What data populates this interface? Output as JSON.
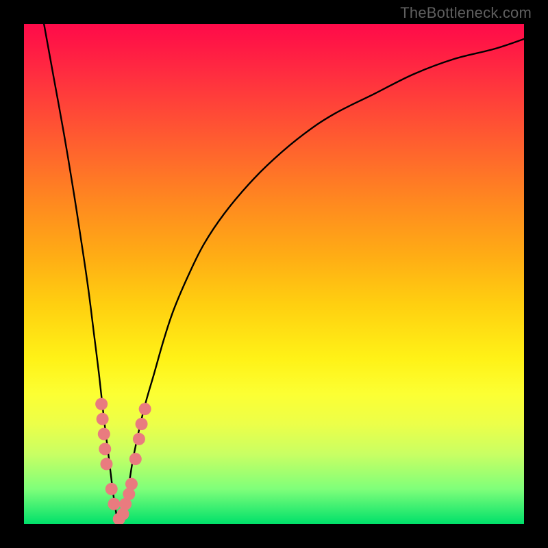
{
  "watermark": "TheBottleneck.com",
  "colors": {
    "curve_stroke": "#000000",
    "marker_fill": "#e97b7f",
    "gradient_top": "#ff0b4a",
    "gradient_bottom": "#00e06a",
    "frame": "#000000"
  },
  "chart_data": {
    "type": "line",
    "title": "",
    "xlabel": "",
    "ylabel": "",
    "xlim": [
      0,
      100
    ],
    "ylim": [
      0,
      100
    ],
    "series": [
      {
        "name": "bottleneck-curve",
        "x": [
          4,
          6,
          8,
          10,
          12,
          13,
          14,
          15,
          16,
          17,
          18,
          19,
          20,
          21,
          22,
          24,
          26,
          28,
          30,
          33,
          36,
          40,
          45,
          50,
          56,
          62,
          70,
          78,
          86,
          94,
          100
        ],
        "y": [
          100,
          89,
          78,
          66,
          53,
          46,
          38,
          30,
          21,
          13,
          5,
          0,
          2,
          8,
          14,
          23,
          30,
          37,
          43,
          50,
          56,
          62,
          68,
          73,
          78,
          82,
          86,
          90,
          93,
          95,
          97
        ]
      }
    ],
    "markers": [
      {
        "x": 15.5,
        "y": 24
      },
      {
        "x": 15.7,
        "y": 21
      },
      {
        "x": 16.0,
        "y": 18
      },
      {
        "x": 16.2,
        "y": 15
      },
      {
        "x": 16.5,
        "y": 12
      },
      {
        "x": 17.5,
        "y": 7
      },
      {
        "x": 18.0,
        "y": 4
      },
      {
        "x": 19.0,
        "y": 1
      },
      {
        "x": 19.8,
        "y": 2
      },
      {
        "x": 20.3,
        "y": 4
      },
      {
        "x": 21.0,
        "y": 6
      },
      {
        "x": 21.5,
        "y": 8
      },
      {
        "x": 22.3,
        "y": 13
      },
      {
        "x": 23.0,
        "y": 17
      },
      {
        "x": 23.5,
        "y": 20
      },
      {
        "x": 24.2,
        "y": 23
      }
    ]
  }
}
